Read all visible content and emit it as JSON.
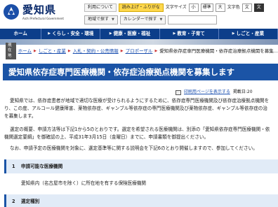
{
  "header": {
    "site_title": "愛知県",
    "site_subtitle": "Aichi Prefectural Government",
    "util": {
      "links_label": "利用について",
      "ruby_label": "読み上げ・ふりがな",
      "size_label": "文字サイズ",
      "size_small": "小",
      "size_std": "標準",
      "size_large": "大",
      "color_label": "文字色",
      "color_chip": "文",
      "color_chip2": "文"
    },
    "search": {
      "region_label": "地域で探す",
      "calendar_label": "カレンダーで探す",
      "placeholder": ""
    }
  },
  "gnav": [
    {
      "label": "ホーム"
    },
    {
      "label": "くらし・安全・環境"
    },
    {
      "label": "健康・医療・福祉"
    },
    {
      "label": "教育・子育て"
    },
    {
      "label": "しごと・産業"
    }
  ],
  "breadcrumb": {
    "here": "現在地",
    "items": [
      "ホーム",
      "しごと・産業",
      "入札・契約・公売情報",
      "プロポーザル"
    ],
    "current": "愛知県依存症専門医療機関・依存症治療拠点機関を募集..."
  },
  "page": {
    "title": "愛知県依存症専門医療機関・依存症治療拠点機関を募集します",
    "print_link": "印刷用ページを表示する",
    "updated": "掲載日:20"
  },
  "intro_paragraph": [
    "愛知県では、依存症患者が地域で適切な医療が受けられるようにするために、依存症専門医療機関及び依存症治療拠点機関を",
    "り、この度、アルコール健康障害、薬物依存症、ギャンブル等依存症の専門医療機関及び薬物依存症、ギャンブル等依存症の治",
    "を募集します。"
  ],
  "apply_paragraph": [
    "選定の概要、申請方法等は下記1から5のとおりです。選定を希望される医療機関は、別添の「愛知県依存症専門医療機関・依",
    "機関選定要綱」を御確認の上、平成31年3月15日（金曜日）までに、申請書類を御提出ください。"
  ],
  "note_paragraph": [
    "なお、申請予定の医療機関を対象に、選定基準等に関する説明会を下記6のとおり開催しますので、参加してください。"
  ],
  "sections": [
    {
      "number": "1",
      "title": "申請可能な医療機関",
      "body": "愛知県内（名古屋市を除く）に所在地を有する保険医療機関"
    },
    {
      "number": "2",
      "title": "選定種別"
    }
  ]
}
